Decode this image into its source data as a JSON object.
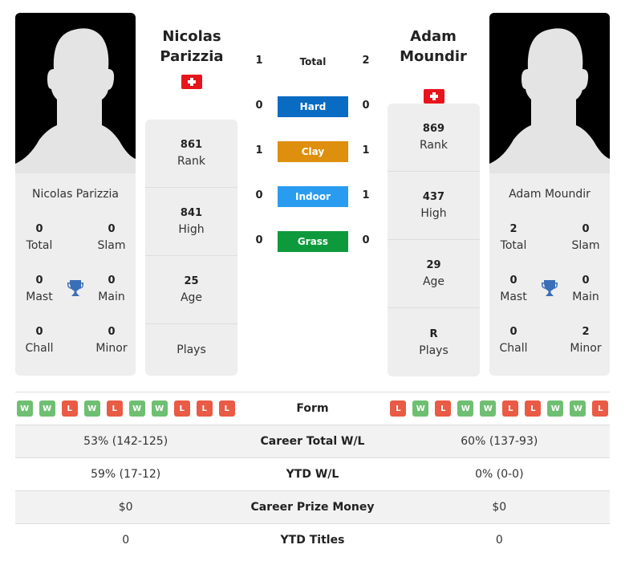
{
  "colors": {
    "hard": "#0a6bc2",
    "clay": "#de8f0e",
    "indoor": "#2a9cf0",
    "grass": "#0e9a3c",
    "win": "#6fbf73",
    "loss": "#e95b45",
    "trophy": "#3a6fb8",
    "flag": "#e8141c"
  },
  "player1": {
    "name_line1": "Nicolas",
    "name_line2": "Parizzia",
    "full_name": "Nicolas Parizzia",
    "flag_icon": "swiss-flag-icon",
    "titles": {
      "total": {
        "value": "0",
        "label": "Total"
      },
      "slam": {
        "value": "0",
        "label": "Slam"
      },
      "mast": {
        "value": "0",
        "label": "Mast"
      },
      "main": {
        "value": "0",
        "label": "Main"
      },
      "chall": {
        "value": "0",
        "label": "Chall"
      },
      "minor": {
        "value": "0",
        "label": "Minor"
      }
    },
    "stats": [
      {
        "value": "861",
        "label": "Rank"
      },
      {
        "value": "841",
        "label": "High"
      },
      {
        "value": "25",
        "label": "Age"
      },
      {
        "value": "",
        "label": "Plays"
      }
    ],
    "form": [
      "W",
      "W",
      "L",
      "W",
      "L",
      "W",
      "W",
      "L",
      "L",
      "L"
    ],
    "career_wl": "53% (142-125)",
    "ytd_wl": "59% (17-12)",
    "prize_money": "$0",
    "ytd_titles": "0"
  },
  "player2": {
    "name_line1": "Adam",
    "name_line2": "Moundir",
    "full_name": "Adam Moundir",
    "flag_icon": "swiss-flag-icon",
    "titles": {
      "total": {
        "value": "2",
        "label": "Total"
      },
      "slam": {
        "value": "0",
        "label": "Slam"
      },
      "mast": {
        "value": "0",
        "label": "Mast"
      },
      "main": {
        "value": "0",
        "label": "Main"
      },
      "chall": {
        "value": "0",
        "label": "Chall"
      },
      "minor": {
        "value": "2",
        "label": "Minor"
      }
    },
    "stats": [
      {
        "value": "869",
        "label": "Rank"
      },
      {
        "value": "437",
        "label": "High"
      },
      {
        "value": "29",
        "label": "Age"
      },
      {
        "value": "R",
        "label": "Plays"
      }
    ],
    "form": [
      "L",
      "W",
      "L",
      "W",
      "W",
      "L",
      "L",
      "W",
      "W",
      "L"
    ],
    "career_wl": "60% (137-93)",
    "ytd_wl": "0% (0-0)",
    "prize_money": "$0",
    "ytd_titles": "0"
  },
  "h2h": {
    "total": {
      "label": "Total",
      "p1": "1",
      "p2": "2"
    },
    "surfaces": [
      {
        "label": "Hard",
        "p1": "0",
        "p2": "0"
      },
      {
        "label": "Clay",
        "p1": "1",
        "p2": "1"
      },
      {
        "label": "Indoor",
        "p1": "0",
        "p2": "1"
      },
      {
        "label": "Grass",
        "p1": "0",
        "p2": "0"
      }
    ]
  },
  "comparison": {
    "form_label": "Form",
    "career_wl_label": "Career Total W/L",
    "ytd_wl_label": "YTD W/L",
    "prize_label": "Career Prize Money",
    "ytd_titles_label": "YTD Titles"
  }
}
